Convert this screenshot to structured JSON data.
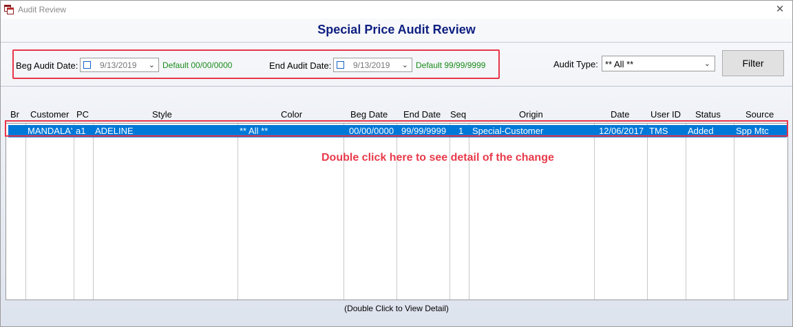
{
  "window": {
    "title": "Audit Review"
  },
  "header": {
    "title": "Special Price Audit Review"
  },
  "filters": {
    "beg_label": "Beg Audit Date:",
    "beg_value": "9/13/2019",
    "beg_default": "Default 00/00/0000",
    "end_label": "End Audit Date:",
    "end_value": "9/13/2019",
    "end_default": "Default 99/99/9999",
    "audit_type_label": "Audit Type:",
    "audit_type_value": "** All **",
    "filter_button": "Filter"
  },
  "grid": {
    "columns": [
      "Br",
      "Customer",
      "PC",
      "Style",
      "Color",
      "Beg Date",
      "End Date",
      "Seq",
      "Origin",
      "Date",
      "User ID",
      "Status",
      "Source"
    ],
    "rows": [
      [
        "",
        "MANDALA'",
        "a1",
        "ADELINE",
        "** All **",
        "00/00/0000",
        "99/99/9999",
        "1",
        "Special-Customer",
        "12/06/2017",
        "TMS",
        "Added",
        "Spp Mtc"
      ]
    ]
  },
  "annotation": "Double click here to see detail of the change",
  "footer": "(Double Click to View Detail)",
  "colors": {
    "header_text": "#0e1f80",
    "selection": "#0078d7",
    "highlight": "#e8344a",
    "default_text": "#1a8c1a"
  },
  "icons": {
    "app": "app-window-icon",
    "close": "close-icon",
    "dropdown": "chevron-down-icon"
  }
}
